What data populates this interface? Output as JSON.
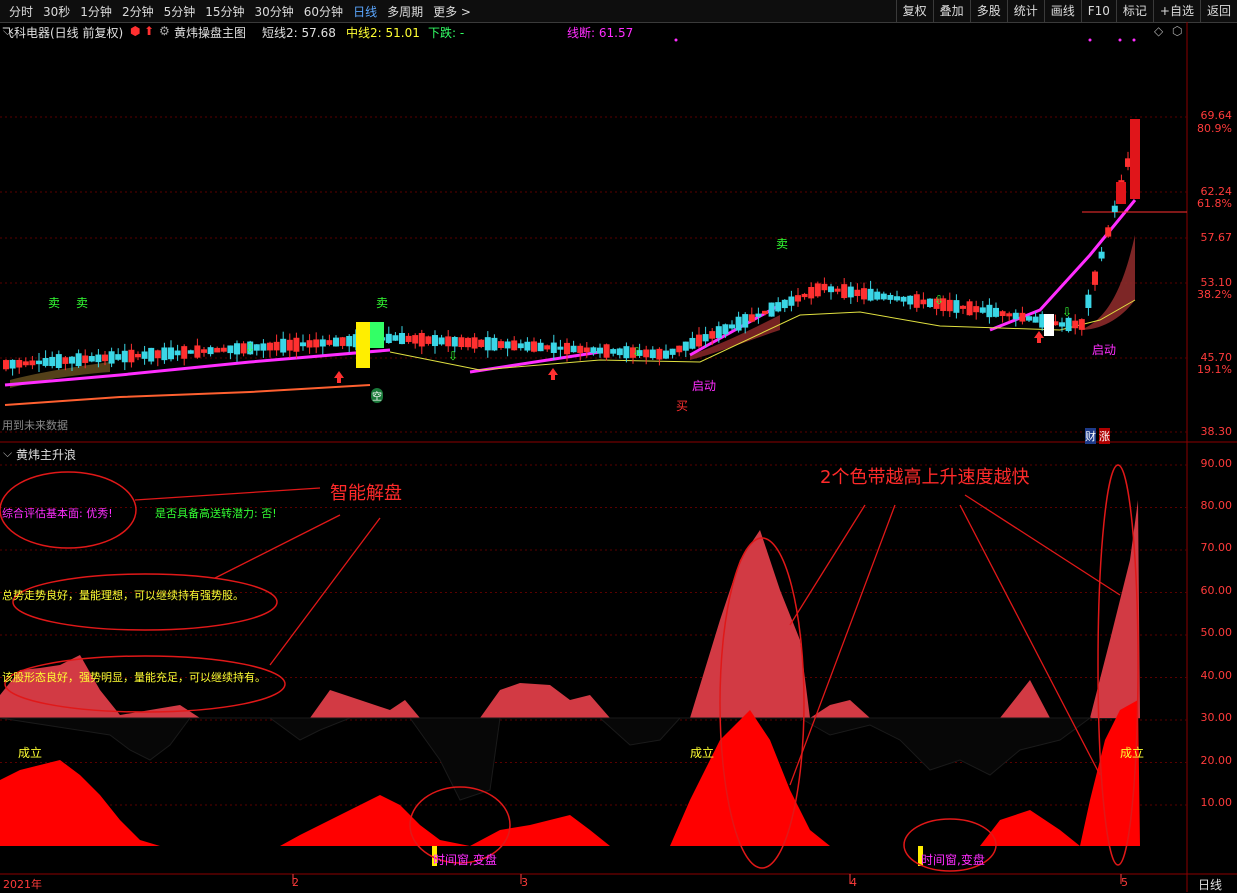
{
  "toolbar": {
    "tabs": [
      "分时",
      "30秒",
      "1分钟",
      "2分钟",
      "5分钟",
      "15分钟",
      "30分钟",
      "60分钟",
      "日线",
      "多周期",
      "更多 >"
    ],
    "active_tab": "日线",
    "tools": [
      "复权",
      "叠加",
      "多股",
      "统计",
      "画线",
      "F10",
      "标记",
      "+自选",
      "返回"
    ]
  },
  "main": {
    "stock_title": "飞科电器(日线 前复权)",
    "indicator_name": "黄炜操盘主图",
    "short_line": "短线2: 57.68",
    "mid_line": "中线2: 51.01",
    "down_label": "下跌: -",
    "break_line": "线断: 61.57",
    "future_note": "用到未来数据",
    "price_labels": [
      {
        "v": "69.64",
        "pct": "80.9%"
      },
      {
        "v": "62.24",
        "pct": "61.8%"
      },
      {
        "v": "57.67",
        "pct": ""
      },
      {
        "v": "53.10",
        "pct": "38.2%"
      },
      {
        "v": "45.70",
        "pct": "19.1%"
      },
      {
        "v": "38.30",
        "pct": ""
      }
    ],
    "signals": {
      "sell": [
        "卖",
        "卖",
        "卖",
        "卖"
      ],
      "buy": "买",
      "start1": "启动",
      "start2": "启动",
      "empty": "空",
      "fin": "财",
      "up": "涨"
    }
  },
  "sub": {
    "title": "黄炜主升浪",
    "eval_fundamental": "综合评估基本面: 优秀!",
    "eval_potential": "是否具备高送转潜力: 否!",
    "trend_note": "总势走势良好，量能理想，可以继续持有强势股。",
    "shape_note": "该股形态良好，强势明显，量能充足，可以继续持有。",
    "annotation_smart": "智能解盘",
    "annotation_bands": "2个色带越高上升速度越快",
    "established": [
      "成立",
      "成立",
      "成立"
    ],
    "time_window": [
      "时间窗,变盘",
      "时间窗,变盘"
    ],
    "axis": [
      "90.00",
      "80.00",
      "70.00",
      "60.00",
      "50.00",
      "40.00",
      "30.00",
      "20.00",
      "10.00"
    ]
  },
  "x_axis": {
    "labels": [
      "2021年",
      "2",
      "3",
      "4",
      "5"
    ],
    "period": "日线"
  },
  "colors": {
    "up": "#ff3030",
    "down": "#3ad6e6",
    "magenta": "#ff2dff",
    "band_light": "#d23a44",
    "band_red": "#ff0000",
    "grid": "#5a0000"
  }
}
